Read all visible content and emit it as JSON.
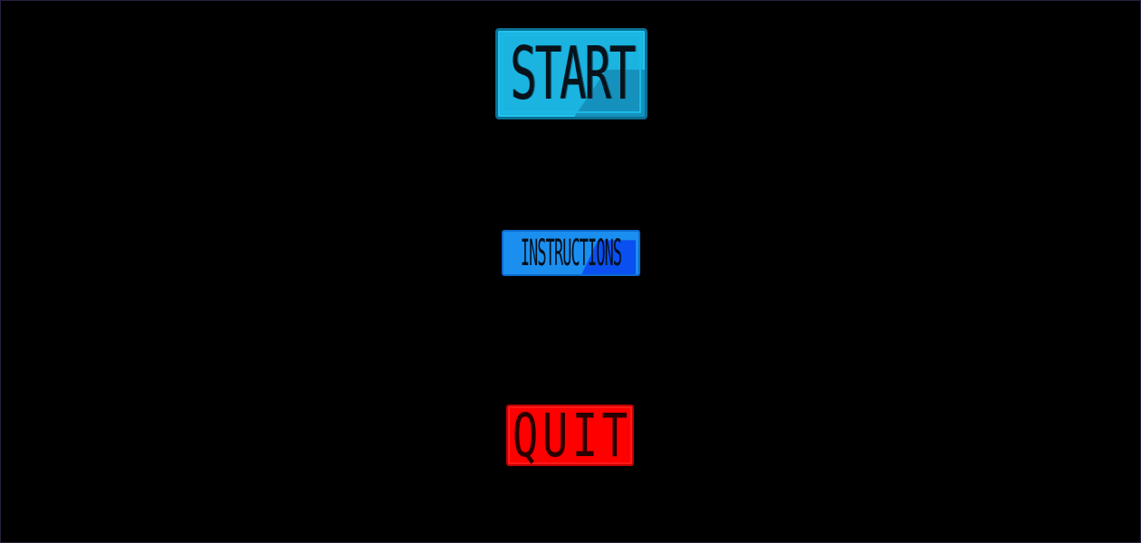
{
  "menu": {
    "start_label": "START",
    "instructions_label": "INSTRUCTIONS",
    "quit_label": "QUIT"
  },
  "colors": {
    "background": "#000000",
    "start": "#1bb3e0",
    "instructions": "#1b8ff0",
    "quit": "#ff0000"
  }
}
